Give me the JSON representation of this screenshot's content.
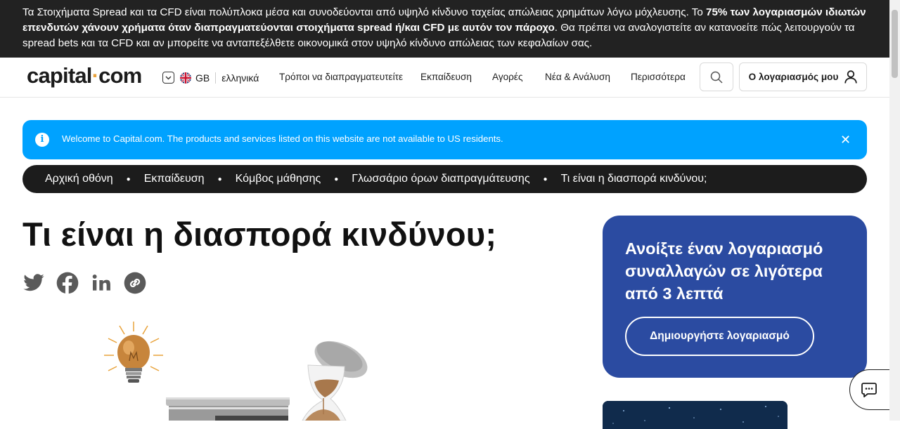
{
  "risk_banner": {
    "part1": "Τα Στοιχήματα Spread και τα CFD είναι πολύπλοκα μέσα και συνοδεύονται από υψηλό κίνδυνο ταχείας απώλειας χρημάτων λόγω μόχλευσης. Το ",
    "bold": "75% των λογαριασμών ιδιωτών επενδυτών χάνουν χρήματα όταν διαπραγματεύονται στοιχήματα spread ή/και CFD με αυτόν τον πάροχο",
    "part2": ". Θα πρέπει να αναλογιστείτε αν κατανοείτε πώς λειτουργούν τα spread bets και τα CFD και αν μπορείτε να ανταπεξέλθετε οικονομικά στον υψηλό κίνδυνο απώλειας των κεφαλαίων σας."
  },
  "header": {
    "logo_left": "capital",
    "logo_right": "com",
    "region": "GB",
    "language": "ελληνικά",
    "nav": [
      "Τρόποι να διαπραγματευτείτε",
      "Εκπαίδευση",
      "Αγορές",
      "Νέα & Ανάλυση",
      "Περισσότερα"
    ],
    "account_label": "Ο λογαριασμός μου"
  },
  "info_bar": {
    "text": "Welcome to Capital.com. The products and services listed on this website are not available to US residents.",
    "icon": "info-icon"
  },
  "breadcrumbs": [
    "Αρχική οθόνη",
    "Εκπαίδευση",
    "Κόμβος μάθησης",
    "Γλωσσάριο όρων διαπραγμάτευσης",
    "Τι είναι η διασπορά κινδύνου;"
  ],
  "page_title": "Τι είναι η διασπορά κινδύνου;",
  "share_icons": [
    "twitter-icon",
    "facebook-icon",
    "linkedin-icon",
    "copy-link-icon"
  ],
  "signup_card": {
    "heading": "Ανοίξτε έναν λογαριασμό συναλλαγών σε λιγότερα από 3 λεπτά",
    "button": "Δημιουργήστε λογαριασμό"
  },
  "colors": {
    "risk_bg": "#222222",
    "info_bg": "#00a2ff",
    "card_bg": "#2b4ba1",
    "logo_accent": "#e9a23b"
  }
}
